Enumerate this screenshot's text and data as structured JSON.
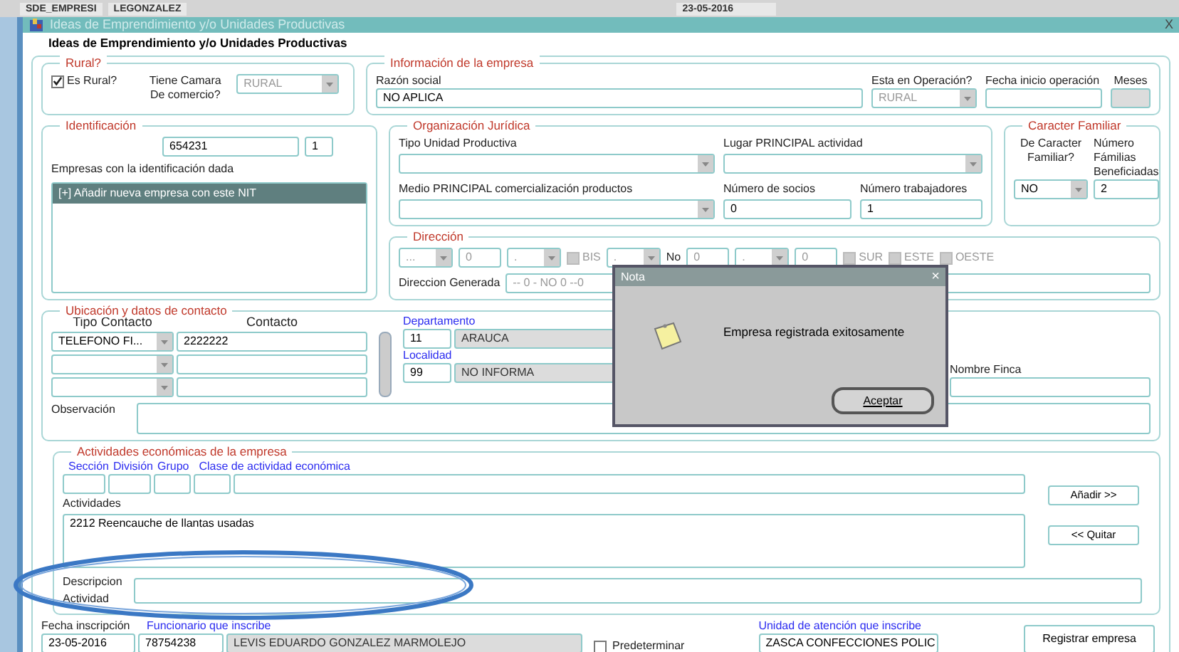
{
  "top_bar": {
    "fields": [
      "SDE_EMPRESI",
      "LEGONZALEZ"
    ],
    "date": "23-05-2016"
  },
  "window": {
    "title": "Ideas de Emprendimiento y/o Unidades Productivas",
    "close": "X"
  },
  "form_title": "Ideas de Emprendimiento y/o Unidades Productivas",
  "rural": {
    "legend": "Rural?",
    "checkbox": {
      "label": "Es Rural?",
      "checked": true
    },
    "camara_label": "Tiene Camara De comercio?",
    "camara_value": "RURAL"
  },
  "empresa": {
    "legend": "Información de la empresa",
    "razon_label": "Razón social",
    "razon_value": "NO APLICA",
    "operacion_label": "Esta en Operación?",
    "operacion_value": "RURAL",
    "fecha_label": "Fecha inicio operación",
    "meses_label": "Meses"
  },
  "identificacion": {
    "legend": "Identificación",
    "id_value": "654231",
    "digit": "1",
    "list_label": "Empresas con la identificación dada",
    "items": [
      {
        "label": "[+] Añadir nueva empresa con este NIT",
        "selected": true
      }
    ]
  },
  "organizacion": {
    "legend": "Organización Jurídica",
    "tipo_label": "Tipo Unidad Productiva",
    "lugar_label": "Lugar PRINCIPAL actividad",
    "medio_label": "Medio PRINCIPAL comercialización productos",
    "socios_label": "Número de socios",
    "socios_value": "0",
    "trabajadores_label": "Número trabajadores",
    "trabajadores_value": "1"
  },
  "familiar": {
    "legend": "Caracter Familiar",
    "caracter_label": "De Caracter Familiar?",
    "caracter_value": "NO",
    "familias_label": "Número Fámilias Beneficiadas",
    "familias_value": "2"
  },
  "direccion": {
    "legend": "Dirección",
    "row": [
      {
        "kind": "select",
        "value": "..."
      },
      {
        "kind": "field",
        "value": "0"
      },
      {
        "kind": "select",
        "value": "."
      },
      {
        "kind": "checkbox",
        "label": "BIS",
        "checked": false,
        "disabled": true
      },
      {
        "kind": "select",
        "value": "."
      },
      {
        "kind": "label",
        "text": "No"
      },
      {
        "kind": "field",
        "value": "0"
      },
      {
        "kind": "select",
        "value": "."
      },
      {
        "kind": "field",
        "value": "0"
      },
      {
        "kind": "checkbox",
        "label": "SUR",
        "checked": false,
        "disabled": true
      },
      {
        "kind": "checkbox",
        "label": "ESTE",
        "checked": false,
        "disabled": true
      },
      {
        "kind": "checkbox",
        "label": "OESTE",
        "checked": false,
        "disabled": true
      }
    ],
    "generada_label": "Direccion Generada",
    "generada_value": "-- 0 - NO  0 --0"
  },
  "contacto": {
    "legend": "Ubicación y datos de contacto",
    "tipo_header": "Tipo Contacto",
    "contacto_header": "Contacto",
    "rows": [
      {
        "tipo": "TELEFONO FI...",
        "contacto": "2222222"
      }
    ],
    "departamento_label": "Departamento",
    "departamento_code": "11",
    "departamento_name": "ARAUCA",
    "localidad_label": "Localidad",
    "localidad_code": "99",
    "localidad_name": "NO INFORMA",
    "finca_label": "Nombre Finca",
    "observacion_label": "Observación"
  },
  "actividades": {
    "legend": "Actividades económicas de la empresa",
    "code_labels": [
      "Sección",
      "División",
      "Grupo",
      "Clase de actividad económica"
    ],
    "actividades_label": "Actividades",
    "items": [
      "2212 Reencauche de llantas usadas"
    ],
    "add_button": "Añadir >>",
    "remove_button": "<< Quitar",
    "descripcion_label": "Descripcion Actividad"
  },
  "footer": {
    "fecha_label": "Fecha inscripción",
    "funcionario_label": "Funcionario que inscribe",
    "fecha_value": "23-05-2016",
    "funcionario_id": "78754238",
    "funcionario_name": "LEVIS EDUARDO GONZALEZ MARMOLEJO",
    "predeterminar": {
      "label": "Predeterminar",
      "checked": false
    },
    "unidad_label": "Unidad de atención que inscribe",
    "unidad_value": "ZASCA CONFECCIONES POLIC",
    "register_button": "Registrar empresa"
  },
  "dialog": {
    "title": "Nota",
    "close": "×",
    "message": "Empresa registrada exitosamente",
    "button": "Aceptar"
  }
}
